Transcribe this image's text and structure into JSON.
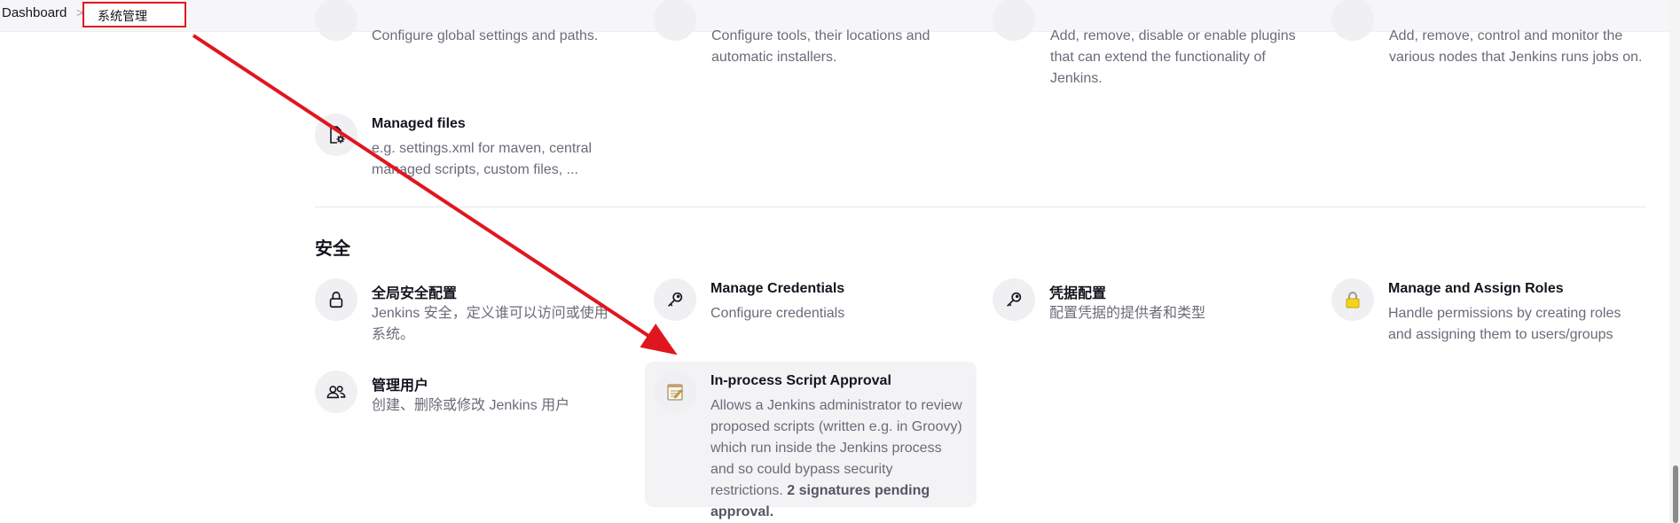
{
  "breadcrumb": {
    "dashboard": "Dashboard",
    "separator": ">",
    "current": "系统管理"
  },
  "top_row": {
    "system_desc": "Configure global settings and paths.",
    "tools_desc": "Configure tools, their locations and automatic installers.",
    "plugins_desc": "Add, remove, disable or enable plugins that can extend the functionality of Jenkins.",
    "nodes_desc": "Add, remove, control and monitor the various nodes that Jenkins runs jobs on."
  },
  "managed_files": {
    "title": "Managed files",
    "desc": "e.g. settings.xml for maven, central managed scripts, custom files, ..."
  },
  "security_section": {
    "title": "安全",
    "items": [
      {
        "title": "全局安全配置",
        "desc": "Jenkins 安全，定义谁可以访问或使用系统。",
        "icon": "lock-icon"
      },
      {
        "title": "Manage Credentials",
        "desc": "Configure credentials",
        "icon": "key-icon"
      },
      {
        "title": "凭据配置",
        "desc": "配置凭据的提供者和类型",
        "icon": "key-icon"
      },
      {
        "title": "Manage and Assign Roles",
        "desc": "Handle permissions by creating roles and assigning them to users/groups",
        "icon": "padlock-icon"
      },
      {
        "title": "管理用户",
        "desc": "创建、删除或修改 Jenkins 用户",
        "icon": "users-icon"
      },
      {
        "title": "In-process Script Approval",
        "desc": "Allows a Jenkins administrator to review proposed scripts (written e.g. in Groovy) which run inside the Jenkins process and so could bypass security restrictions.",
        "desc_bold": "2 signatures pending approval.",
        "icon": "notepad-icon"
      }
    ]
  },
  "colors": {
    "annotation_red": "#e0161e",
    "text_primary": "#14141f",
    "text_secondary": "#6b6b79"
  }
}
